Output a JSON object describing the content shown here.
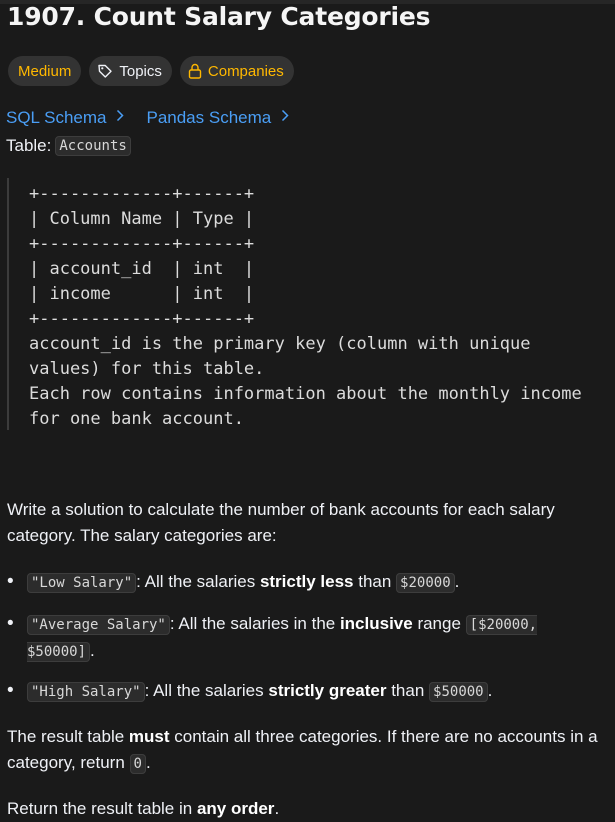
{
  "problem": {
    "title": "1907. Count Salary Categories",
    "tags": {
      "difficulty": "Medium",
      "topics": "Topics",
      "companies": "Companies"
    },
    "schemas": [
      "SQL Schema",
      "Pandas Schema"
    ],
    "table_label": "Table:",
    "table_name": "Accounts",
    "code_lines": [
      "+-------------+------+",
      "| Column Name | Type |",
      "+-------------+------+",
      "| account_id  | int  |",
      "| income      | int  |",
      "+-------------+------+",
      "account_id is the primary key (column with unique",
      "values) for this table.",
      "Each row contains information about the monthly income",
      "for one bank account."
    ],
    "intro": "Write a solution to calculate the number of bank accounts for each salary category. The salary categories are:",
    "low": {
      "code": "\"Low Salary\"",
      "t1": ": All the salaries ",
      "bold": "strictly less",
      "t2": " than ",
      "val": "$20000",
      "t3": "."
    },
    "avg": {
      "code": "\"Average Salary\"",
      "t1": ": All the salaries in the ",
      "bold": "inclusive",
      "t2": " range ",
      "val": "[$20000, $50000]",
      "t3": "."
    },
    "high": {
      "code": "\"High Salary\"",
      "t1": ": All the salaries ",
      "bold": "strictly greater",
      "t2": " than ",
      "val": "$50000",
      "t3": "."
    },
    "result": {
      "t1": "The result table ",
      "bold": "must",
      "t2": " contain all three categories. If there are no accounts in a category, return ",
      "val": "0",
      "t3": "."
    },
    "order": {
      "t1": "Return the result table in ",
      "bold": "any order",
      "t2": "."
    }
  },
  "colors": {
    "accent_link": "#4a9ef5",
    "medium": "#ffb800",
    "background": "#1a1a1a"
  },
  "icons": {
    "topics": "tag-icon",
    "companies": "lock-icon",
    "schema_chevron": "chevron-right-icon"
  }
}
